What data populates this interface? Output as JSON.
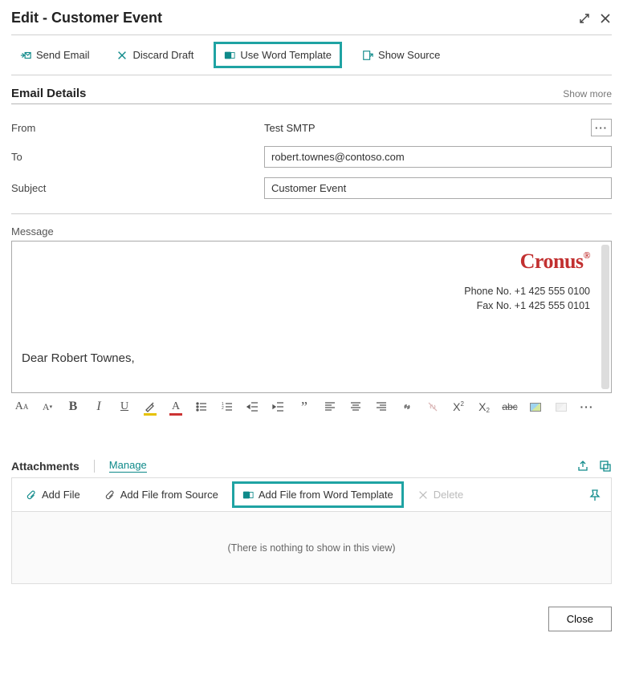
{
  "header": {
    "title": "Edit - Customer Event"
  },
  "toolbar": {
    "send_email": "Send Email",
    "discard_draft": "Discard Draft",
    "use_word_template": "Use Word Template",
    "show_source": "Show Source"
  },
  "section": {
    "title": "Email Details",
    "show_more": "Show more"
  },
  "form": {
    "from_label": "From",
    "from_value": "Test SMTP",
    "ellipsis": "···",
    "to_label": "To",
    "to_value": "robert.townes@contoso.com",
    "subject_label": "Subject",
    "subject_value": "Customer Event"
  },
  "message": {
    "label": "Message",
    "logo_text": "Cronus",
    "logo_mark": "®",
    "phone_line": "Phone No. +1 425 555 0100",
    "fax_line": "Fax No. +1 425 555 0101",
    "greeting": "Dear Robert Townes,"
  },
  "attachments": {
    "title": "Attachments",
    "manage": "Manage",
    "add_file": "Add File",
    "add_file_from_source": "Add File from Source",
    "add_file_from_word_template": "Add File from Word Template",
    "delete": "Delete",
    "empty": "(There is nothing to show in this view)"
  },
  "footer": {
    "close": "Close"
  }
}
